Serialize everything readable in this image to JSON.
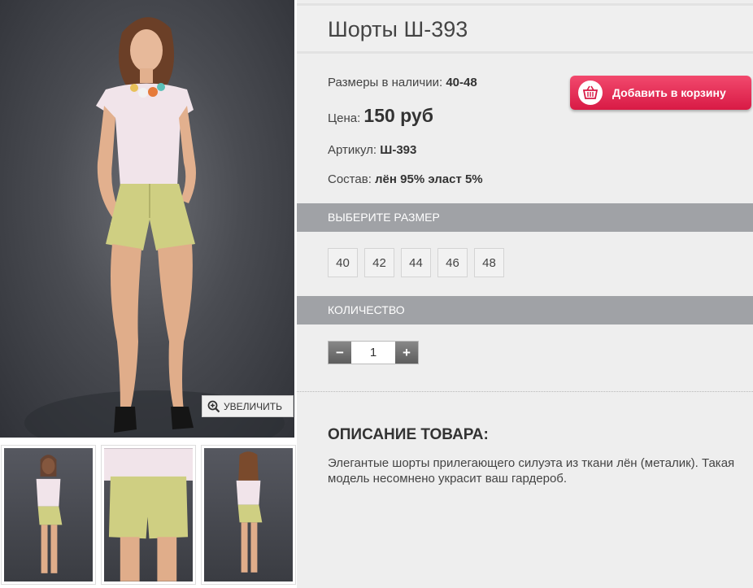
{
  "gallery": {
    "zoom_label": "УВЕЛИЧИТЬ",
    "zoom_icon": "magnifier-plus-icon",
    "colors": {
      "backdrop": "#4a4c52",
      "top": "#f1e4ea",
      "shorts": "#cfcf82"
    }
  },
  "product": {
    "title": "Шорты Ш-393",
    "sizes_available_label": "Размеры в наличии:",
    "sizes_available_value": "40-48",
    "price_label": "Цена:",
    "price_value": "150 руб",
    "sku_label": "Артикул:",
    "sku_value": "Ш-393",
    "composition_label": "Состав:",
    "composition_value": "лён 95% эласт 5%"
  },
  "cart": {
    "label": "Добавить в корзину",
    "icon": "basket-icon",
    "color": "#e0234f"
  },
  "size_section": {
    "header": "ВЫБЕРИТЕ РАЗМЕР",
    "options": [
      "40",
      "42",
      "44",
      "46",
      "48"
    ]
  },
  "quantity_section": {
    "header": "КОЛИЧЕСТВО",
    "minus": "−",
    "plus": "+",
    "value": "1"
  },
  "description": {
    "title": "ОПИСАНИЕ ТОВАРА:",
    "text": "Элегантые шорты прилегающего силуэта из ткани лён (металик). Такая модель несомнено украсит ваш гардероб."
  }
}
